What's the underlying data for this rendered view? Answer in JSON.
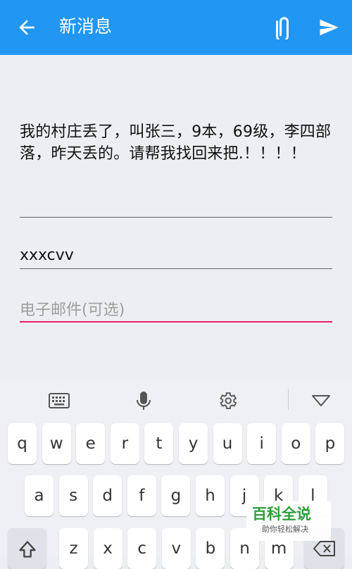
{
  "header": {
    "title": "新消息",
    "accent": "#2196f3",
    "icons": [
      "back-arrow-icon",
      "paperclip-icon",
      "send-icon"
    ]
  },
  "form": {
    "message": "我的村庄丢了，叫张三，9本，69级，李四部落，昨天丢的。请帮我找回来把.！！！！",
    "name_value": "xxxcvv",
    "email_placeholder": "电子邮件(可选)",
    "focused_underline": "#e91e63"
  },
  "keyboard": {
    "toolbar_icons": [
      "keyboard-icon",
      "microphone-icon",
      "gear-icon",
      "hide-keyboard-icon"
    ],
    "row1": [
      "q",
      "w",
      "e",
      "r",
      "t",
      "y",
      "u",
      "i",
      "o",
      "p"
    ],
    "row2": [
      "a",
      "s",
      "d",
      "f",
      "g",
      "h",
      "j",
      "k",
      "l"
    ],
    "row3": [
      "z",
      "x",
      "c",
      "v",
      "b",
      "n",
      "m"
    ],
    "shift_icon": "shift-icon",
    "backspace_icon": "backspace-icon"
  },
  "watermark": {
    "title": "百科全说",
    "subtitle": "助你轻松解决"
  }
}
